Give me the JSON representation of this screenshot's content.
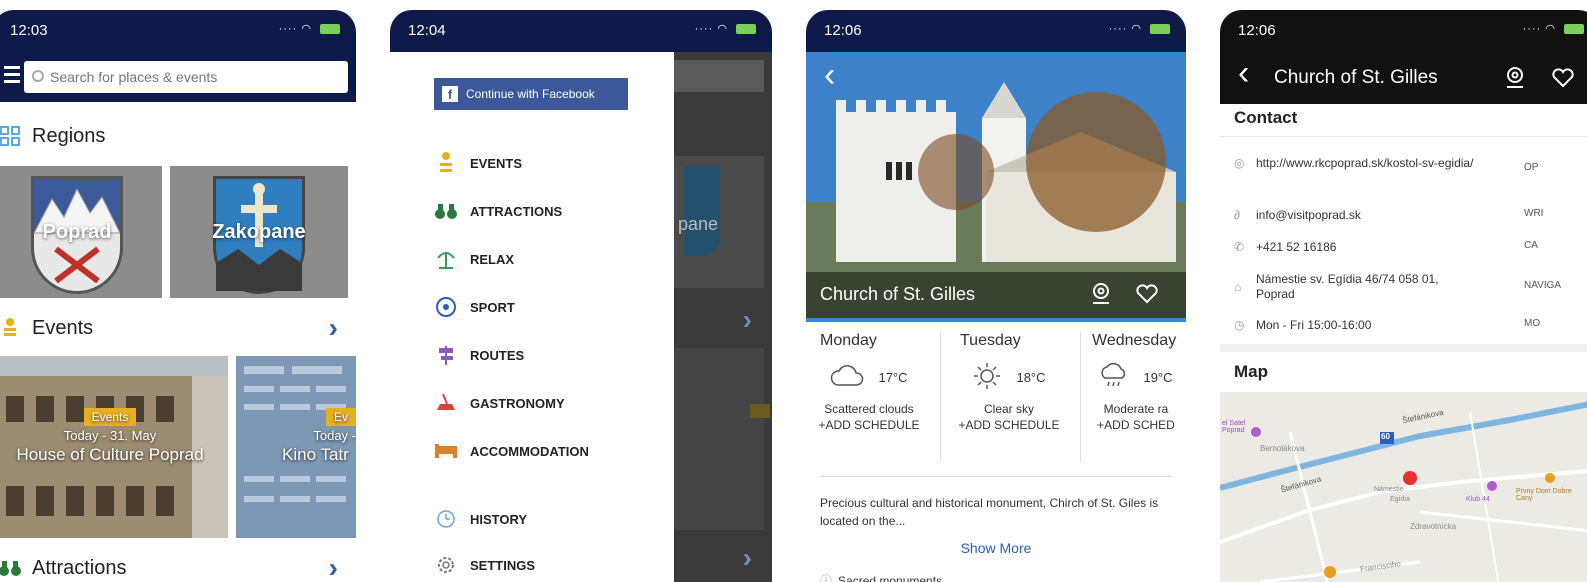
{
  "phone1": {
    "time": "12:03",
    "search_placeholder": "Search for places & events",
    "regions_title": "Regions",
    "regions": [
      {
        "name": "Poprad"
      },
      {
        "name": "Zakopane"
      }
    ],
    "events_title": "Events",
    "events": [
      {
        "tag": "Events",
        "date": "Today - 31. May",
        "name": "House of Culture Poprad"
      },
      {
        "tag": "Ev",
        "date": "Today -",
        "name": "Kino Tatr"
      }
    ],
    "attractions_title": "Attractions"
  },
  "phone2": {
    "time": "12:04",
    "facebook_label": "Continue with Facebook",
    "menu": [
      {
        "label": "EVENTS",
        "icon": "events-icon"
      },
      {
        "label": "ATTRACTIONS",
        "icon": "binoculars-icon"
      },
      {
        "label": "RELAX",
        "icon": "palm-icon"
      },
      {
        "label": "SPORT",
        "icon": "ball-icon"
      },
      {
        "label": "ROUTES",
        "icon": "signpost-icon"
      },
      {
        "label": "GASTRONOMY",
        "icon": "food-icon"
      },
      {
        "label": "ACCOMMODATION",
        "icon": "bed-icon"
      },
      {
        "label": "HISTORY",
        "icon": "clock-icon"
      },
      {
        "label": "SETTINGS",
        "icon": "gear-icon"
      }
    ],
    "bg_text": "pane"
  },
  "phone3": {
    "time": "12:06",
    "title": "Church of St. Gilles",
    "weather": [
      {
        "day": "Monday",
        "temp": "17°C",
        "desc": "Scattered clouds",
        "add": "+ADD SCHEDULE"
      },
      {
        "day": "Tuesday",
        "temp": "18°C",
        "desc": "Clear sky",
        "add": "+ADD SCHEDULE"
      },
      {
        "day": "Wednesday",
        "temp": "19°C",
        "desc": "Moderate ra",
        "add": "+ADD SCHED"
      }
    ],
    "description": "Precious cultural and historical monument, Chirch of St. Giles is located on the...",
    "show_more": "Show More",
    "category": "Sacred monuments"
  },
  "phone4": {
    "time": "12:06",
    "title": "Church of St. Gilles",
    "contact_title": "Contact",
    "contacts": [
      {
        "text": "http://www.rkcpoprad.sk/kostol-sv-egidia/",
        "action": "OP"
      },
      {
        "text": "info@visitpoprad.sk",
        "action": "WRI"
      },
      {
        "text": "+421 52 16186",
        "action": "CA"
      },
      {
        "text": "Námestie sv. Egídia 46/74 058 01, Poprad",
        "action": "NAVIGA"
      },
      {
        "text": "Mon - Fri 15:00-16:00",
        "action": "MO"
      }
    ],
    "map_title": "Map",
    "map_labels": [
      "Štefánikova",
      "Štefánikova",
      "Bernolákova",
      "Francisciho",
      "Zdravotnícka",
      "Klub 44",
      "Prvny Dom Dobre Cany",
      "Námestie",
      "Egídia",
      "60",
      "el Satel Poprad"
    ]
  },
  "colors": {
    "navy": "#101a4a",
    "accent_blue": "#2a5fbf",
    "event_tag": "#e6b020",
    "facebook": "#3b5998"
  }
}
